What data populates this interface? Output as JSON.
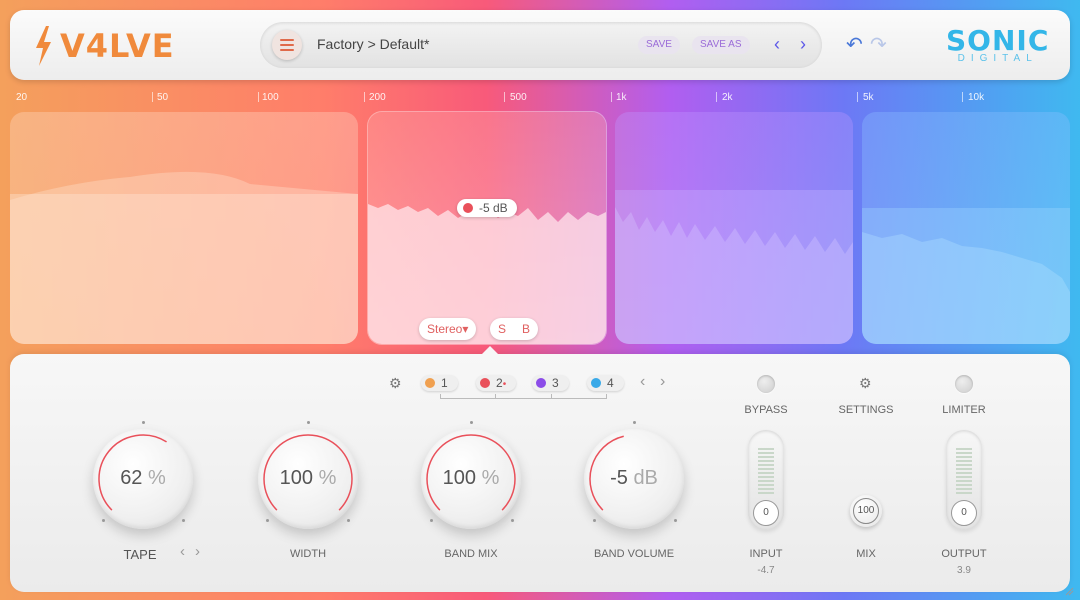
{
  "app": {
    "logo_text": "V4LVE"
  },
  "preset": {
    "path": "Factory > Default*",
    "save": "SAVE",
    "save_as": "SAVE AS",
    "prev": "‹",
    "next": "›"
  },
  "history": {
    "undo": "↶",
    "redo": "↷"
  },
  "brand": {
    "name": "SONIC",
    "sub": "DIGITAL"
  },
  "frequencies": [
    "20",
    "50",
    "100",
    "200",
    "500",
    "1k",
    "2k",
    "5k",
    "10k"
  ],
  "band_overlay": {
    "gain_label": "-5 dB",
    "stereo_label": "Stereo▾",
    "solo": "S",
    "bypass": "B"
  },
  "band_tabs": [
    {
      "label": "1",
      "color": "#f0a050"
    },
    {
      "label": "2",
      "color": "#e9505a",
      "marker": "•"
    },
    {
      "label": "3",
      "color": "#8b4ce8"
    },
    {
      "label": "4",
      "color": "#39a9e8"
    }
  ],
  "knobs": [
    {
      "name": "tape",
      "value": "62",
      "unit": "%",
      "label": "TAPE",
      "level": 0.62
    },
    {
      "name": "width",
      "value": "100",
      "unit": "%",
      "label": "WIDTH",
      "level": 1.0
    },
    {
      "name": "band-mix",
      "value": "100",
      "unit": "%",
      "label": "BAND MIX",
      "level": 1.0
    },
    {
      "name": "band-volume",
      "value": "-5",
      "unit": "dB",
      "label": "BAND VOLUME",
      "level": 0.45
    }
  ],
  "tape_nav": {
    "prev": "‹",
    "next": "›"
  },
  "right": {
    "bypass": "BYPASS",
    "settings": "SETTINGS",
    "limiter": "LIMITER",
    "input": {
      "label": "INPUT",
      "knob": "0",
      "value": "-4.7"
    },
    "mix": {
      "label": "MIX",
      "knob": "100"
    },
    "output": {
      "label": "OUTPUT",
      "knob": "0",
      "value": "3.9"
    }
  },
  "colors": {
    "accent": "#e9505a",
    "orange": "#f08a3c",
    "purple": "#5b57e8",
    "blue": "#33b6e8"
  }
}
